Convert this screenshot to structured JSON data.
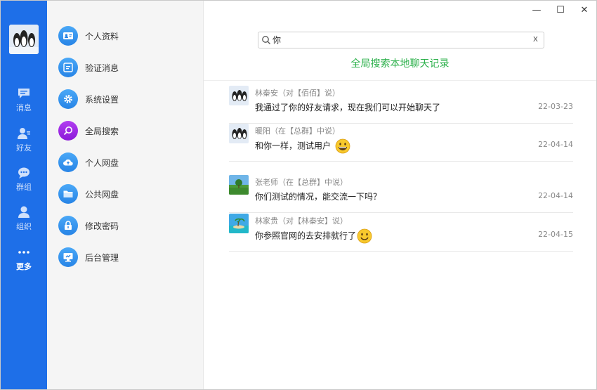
{
  "rail": {
    "items": [
      {
        "label": "消息",
        "icon": "chat-icon"
      },
      {
        "label": "好友",
        "icon": "friends-icon"
      },
      {
        "label": "群组",
        "icon": "group-chat-icon"
      },
      {
        "label": "组织",
        "icon": "organization-icon"
      },
      {
        "label": "更多",
        "icon": "more-icon"
      }
    ]
  },
  "menu": {
    "items": [
      {
        "label": "个人资料",
        "icon": "id-card-icon"
      },
      {
        "label": "验证消息",
        "icon": "document-icon"
      },
      {
        "label": "系统设置",
        "icon": "settings-icon"
      },
      {
        "label": "全局搜索",
        "icon": "search-icon"
      },
      {
        "label": "个人网盘",
        "icon": "cloud-upload-icon"
      },
      {
        "label": "公共网盘",
        "icon": "folder-icon"
      },
      {
        "label": "修改密码",
        "icon": "lock-icon"
      },
      {
        "label": "后台管理",
        "icon": "admin-icon"
      }
    ]
  },
  "window": {
    "minimize": "—",
    "maximize": "☐",
    "close": "✕"
  },
  "search": {
    "value": "你",
    "clear": "x"
  },
  "global_search_label": "全局搜索本地聊天记录",
  "results": [
    {
      "from": "林秦安（对【佰佰】说）",
      "message": "我通过了你的好友请求，现在我们可以开始聊天了",
      "date": "22-03-23",
      "avatar": "penguin"
    },
    {
      "from": "暖阳（在【总群】中说）",
      "message": "和你一样，测试用户",
      "date": "22-04-14",
      "avatar": "penguin",
      "emoji": "grin"
    },
    {
      "from": "张老师（在【总群】中说）",
      "message": "你们测试的情况，能交流一下吗？",
      "date": "22-04-14",
      "avatar": "landscape"
    },
    {
      "from": "林家贵（对【林秦安】说）",
      "message": "你参照官网的去安排就行了",
      "date": "22-04-15",
      "avatar": "beach",
      "emoji": "smile"
    }
  ],
  "colors": {
    "rail": "#1e6fe8",
    "accent_green": "#2bb04a",
    "active_menu": "#9a27e3"
  }
}
